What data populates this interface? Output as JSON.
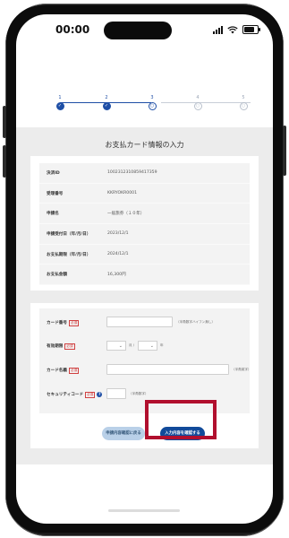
{
  "status_bar": {
    "time": "00:00"
  },
  "stepper": {
    "steps": [
      {
        "num": "1",
        "state": "done",
        "mark": "✓"
      },
      {
        "num": "2",
        "state": "done",
        "mark": "✓"
      },
      {
        "num": "3",
        "state": "current",
        "mark": "○"
      },
      {
        "num": "4",
        "state": "todo",
        "mark": "○"
      },
      {
        "num": "5",
        "state": "todo",
        "mark": "○"
      }
    ]
  },
  "page_title": "お支払カード情報の入力",
  "info": {
    "rows": [
      {
        "label": "決済ID",
        "value": "1002312310859417359"
      },
      {
        "label": "受理番号",
        "value": "KKRYOKR0001"
      },
      {
        "label": "申請名",
        "value": "一般旅券（１０年）"
      },
      {
        "label": "申請受付日（年/月/日）",
        "value": "2023/12/1"
      },
      {
        "label": "お支払期限（年/月/日）",
        "value": "2024/12/1"
      },
      {
        "label": "お支払金額",
        "value": "16,300円"
      }
    ]
  },
  "form": {
    "card_number": {
      "label": "カード番号",
      "required": "必須",
      "value": "",
      "note": "（半角数字ハイフン無し）"
    },
    "expiry": {
      "label": "有効期限",
      "required": "必須",
      "month_value": "",
      "month_unit": "月 /",
      "year_value": "",
      "year_unit": "年"
    },
    "card_name": {
      "label": "カード名義",
      "required": "必須",
      "value": "",
      "note": "（半角英字）"
    },
    "security_code": {
      "label": "セキュリティコード",
      "required": "必須",
      "help": "?",
      "value": "",
      "note": "（半角数字）"
    }
  },
  "buttons": {
    "back": "申請内容確認に戻る",
    "confirm": "入力内容を確認する"
  },
  "colors": {
    "accent": "#114a9a",
    "highlight": "#b10f2e",
    "required": "#d04040"
  }
}
